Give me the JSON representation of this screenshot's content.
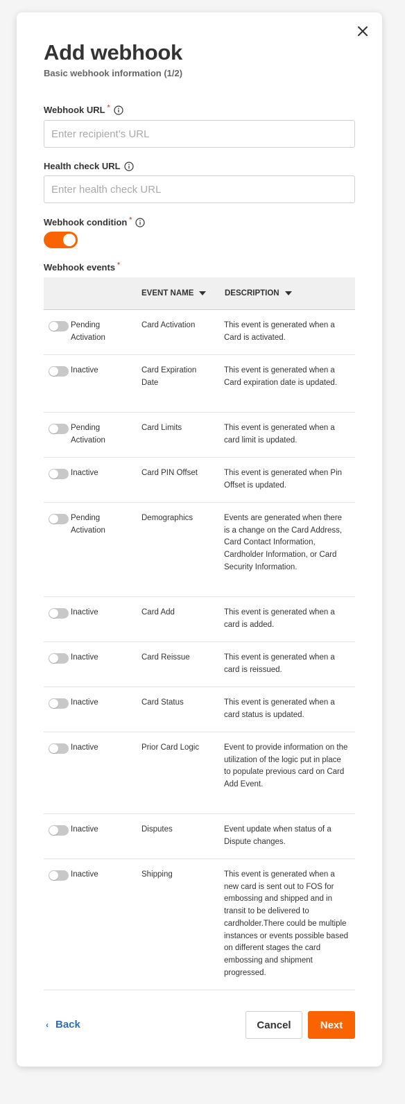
{
  "modal": {
    "title": "Add webhook",
    "subtitle": "Basic webhook information (1/2)"
  },
  "fields": {
    "webhook_url": {
      "label": "Webhook URL",
      "required": "*",
      "placeholder": "Enter recipient’s URL"
    },
    "health_url": {
      "label": "Health check URL",
      "placeholder": "Enter health check URL"
    },
    "condition": {
      "label": "Webhook condition",
      "required": "*",
      "enabled": true
    },
    "events_label": "Webhook events",
    "events_required": "*"
  },
  "table": {
    "headers": {
      "name": "EVENT NAME",
      "description": "DESCRIPTION"
    },
    "rows": [
      {
        "status": "Pending Activation",
        "name": "Card Activation",
        "description": "This event is generated when a Card is activated."
      },
      {
        "status": "Inactive",
        "name": "Card Expiration Date",
        "description": "This event is generated when a Card expiration date is updated."
      },
      {
        "status": "Pending Activation",
        "name": "Card Limits",
        "description": "This event is generated when a card limit is updated."
      },
      {
        "status": "Inactive",
        "name": "Card PIN Offset",
        "description": "This event is generated when Pin Offset is updated."
      },
      {
        "status": "Pending Activation",
        "name": "Demographics",
        "description": "Events are generated when there is a change on the Card Address, Card Contact Information, Cardholder Information, or Card Security Information."
      },
      {
        "status": "Inactive",
        "name": "Card Add",
        "description": "This event is generated when a card is added."
      },
      {
        "status": "Inactive",
        "name": "Card Reissue",
        "description": "This event is generated when a card is reissued."
      },
      {
        "status": "Inactive",
        "name": "Card Status",
        "description": "This event is generated when a card status is updated."
      },
      {
        "status": "Inactive",
        "name": "Prior Card Logic",
        "description": "Event to provide information on the utilization of the logic put in place to populate previous card on Card Add Event."
      },
      {
        "status": "Inactive",
        "name": "Disputes",
        "description": "Event update when status of a Dispute changes."
      },
      {
        "status": "Inactive",
        "name": "Shipping",
        "description": "This event is generated when a new card is sent out to FOS for embossing and shipped and in transit to be delivered to cardholder.There could be multiple instances or events possible based on different stages the card embossing and shipment progressed."
      }
    ]
  },
  "footer": {
    "back_label": "Back",
    "cancel_label": "Cancel",
    "next_label": "Next"
  },
  "colors": {
    "accent": "#f96302",
    "link": "#2a6ebb",
    "required": "#e84c3d"
  }
}
